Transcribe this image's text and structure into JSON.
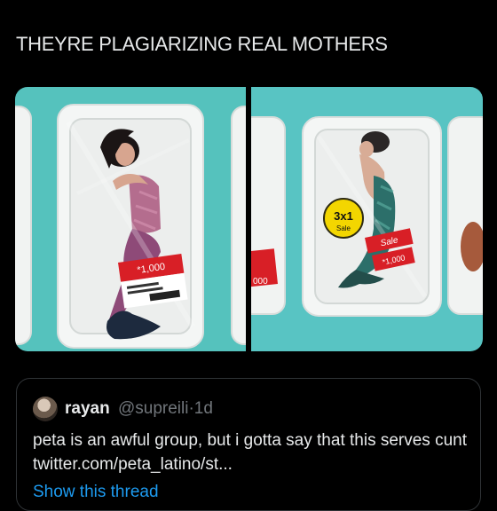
{
  "tweet": {
    "text": "THEYRE PLAGIARIZING REAL MOTHERS"
  },
  "media": {
    "left_image": {
      "price_tag": "*1,000"
    },
    "right_image": {
      "badge_main": "3x1",
      "badge_sub": "Sale",
      "sale_tag": "Sale",
      "price_tag": "*1,000",
      "edge_tag": "000"
    },
    "colors": {
      "background_teal": "#55c2bd",
      "tray_white": "#f4f6f5",
      "price_red": "#d81f26",
      "badge_yellow": "#f3d600"
    }
  },
  "quote": {
    "name": "rayan",
    "handle": "@supreili",
    "separator": "·",
    "time": "1d",
    "body": "peta is an awful group, but i gotta say that this serves cunt twitter.com/peta_latino/st...",
    "show_thread": "Show this thread"
  }
}
